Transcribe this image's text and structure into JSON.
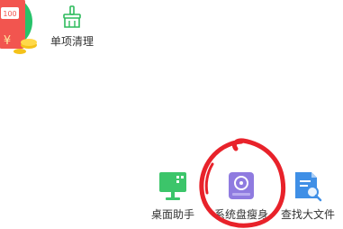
{
  "promo": {
    "badge_text": "100",
    "currency_symbol": "¥",
    "icon": "red-packet-icon"
  },
  "tools": {
    "single_cleanup": {
      "label": "单项清理",
      "icon": "broom-icon",
      "color": "#2dbb5c"
    },
    "desktop_assistant": {
      "label": "桌面助手",
      "icon": "monitor-icon",
      "color": "#3cc56a"
    },
    "disk_slim": {
      "label": "系统盘瘦身",
      "icon": "disk-icon",
      "color": "#8f7be0"
    },
    "find_big_files": {
      "label": "查找大文件",
      "icon": "file-search-icon",
      "color": "#3f8fe6"
    }
  },
  "annotation": {
    "color": "#e8222a"
  }
}
